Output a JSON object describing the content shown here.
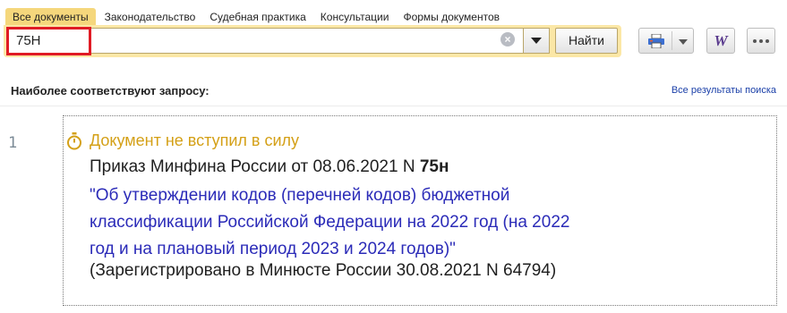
{
  "tabs": [
    "Все документы",
    "Законодательство",
    "Судебная практика",
    "Консультации",
    "Формы документов"
  ],
  "search": {
    "value": "75Н",
    "find_label": "Найти"
  },
  "results": {
    "heading": "Наиболее соответствуют запросу:",
    "all_results_link": "Все результаты поиска"
  },
  "result_item": {
    "number": "1",
    "status": "Документ не вступил в силу",
    "title_prefix": "Приказ Минфина России от 08.06.2021 N ",
    "title_bold": "75н",
    "name_lines": [
      "\"Об утверждении кодов (перечней кодов) бюджетной",
      "классификации Российской Федерации на 2022 год (на 2022",
      "год и на плановый период 2023 и 2024 годов)\""
    ],
    "registration": "(Зарегистрировано в Минюсте России 30.08.2021 N 64794)"
  },
  "toolbar": {
    "word_label": "W"
  },
  "colors": {
    "tab_active": "#f5d77c",
    "search_band": "#fbe7a6",
    "status": "#d4a017",
    "doc_name": "#2b2bb8",
    "highlight": "#e01b24"
  },
  "icons": [
    "clear-icon",
    "chevron-down-icon",
    "printer-icon",
    "word-icon",
    "more-icon",
    "stopwatch-icon"
  ]
}
